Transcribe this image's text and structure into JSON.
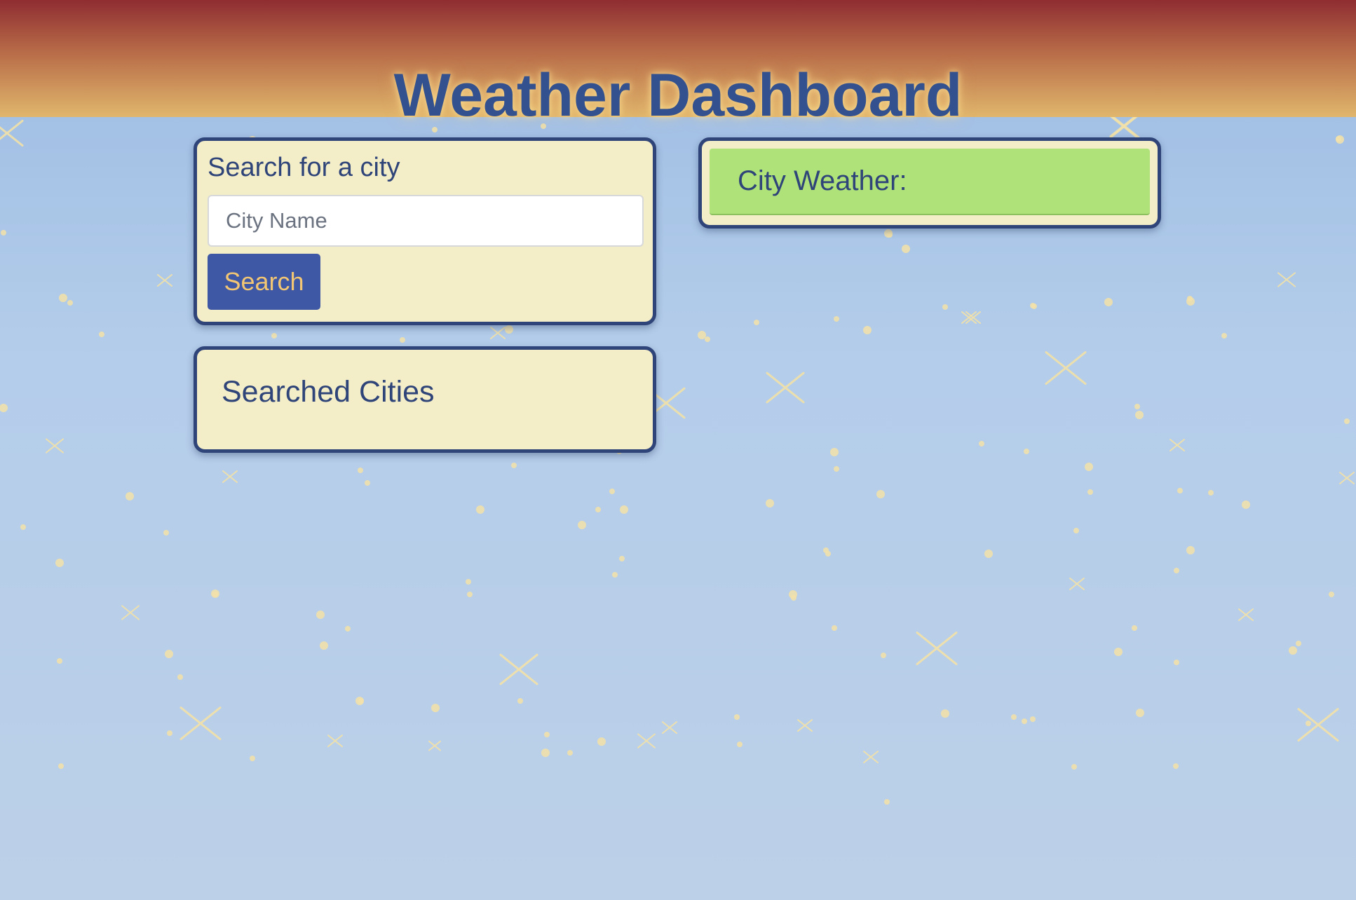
{
  "header": {
    "title": "Weather Dashboard"
  },
  "search": {
    "heading": "Search for a city",
    "input_placeholder": "City Name",
    "input_value": "",
    "button_label": "Search"
  },
  "history": {
    "heading": "Searched Cities",
    "cities": []
  },
  "weather": {
    "title": "City Weather:"
  },
  "colors": {
    "header_top": "#8f2d32",
    "header_bottom": "#e0b66c",
    "title_text": "#34518f",
    "card_background": "#f3edc8",
    "card_border": "#2f4478",
    "button_background": "#3e58a5",
    "button_text": "#f2c673",
    "weather_header": "#afe37a",
    "sky": "#b4cdea",
    "sparkle": "#f3e2a8"
  }
}
